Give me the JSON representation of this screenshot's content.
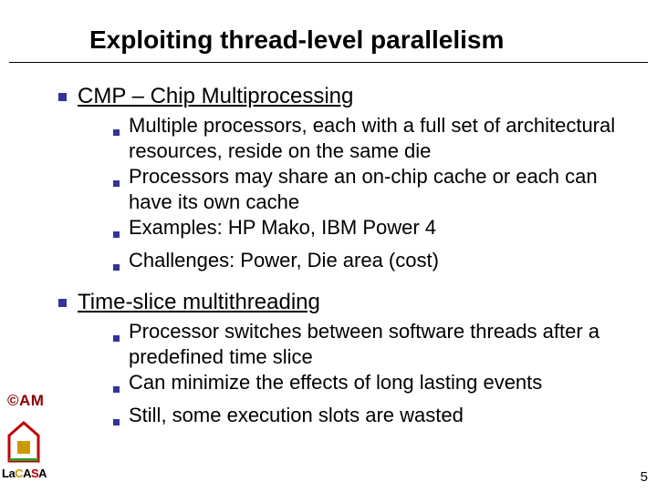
{
  "title": "Exploiting thread-level parallelism",
  "topics": [
    {
      "heading": "CMP – Chip Multiprocessing",
      "points": [
        "Multiple processors, each with a full set of architectural resources, reside on the same die",
        "Processors may share an on-chip cache or each can have its own cache",
        "Examples: HP Mako, IBM Power 4",
        "Challenges: Power, Die area (cost)"
      ]
    },
    {
      "heading": "Time-slice multithreading",
      "points": [
        "Processor switches between software threads after a predefined time slice",
        "Can minimize the effects of long lasting events",
        "Still, some execution slots are wasted"
      ]
    }
  ],
  "am_text": "©AM",
  "lacasa": {
    "la": "La",
    "c": "C",
    "a": "A",
    "s": "S",
    "a2": "A"
  },
  "page_number": "5"
}
